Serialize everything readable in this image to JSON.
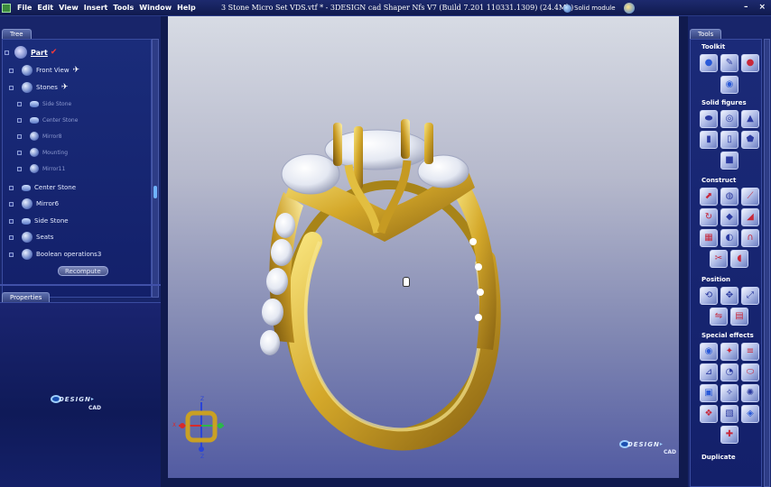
{
  "menubar": {
    "items": [
      "File",
      "Edit",
      "View",
      "Insert",
      "Tools",
      "Window",
      "Help"
    ],
    "title": "3 Stone Micro Set VDS.vtf * -  3DESIGN cad Shaper Nfs V7  (Build 7.201 110331.1309)  (24.4Mb)",
    "solid_module": "Solid module",
    "min_symbol": "–",
    "close_symbol": "×"
  },
  "tree": {
    "tab": "Tree",
    "part_label": "Part",
    "part_check": "✔",
    "items": [
      {
        "label": "Front View",
        "wing": "✈"
      },
      {
        "label": "Stones",
        "wing": "✈"
      },
      {
        "label": "Side Stone"
      },
      {
        "label": "Center Stone"
      },
      {
        "label": "Mirror8"
      },
      {
        "label": "Mounting"
      },
      {
        "label": "Mirror11"
      },
      {
        "label": "Center Stone"
      },
      {
        "label": "Mirror6"
      },
      {
        "label": "Side Stone"
      },
      {
        "label": "Seats"
      },
      {
        "label": "Boolean operations3"
      }
    ],
    "recompute": "Recompute"
  },
  "properties": {
    "tab": "Properties"
  },
  "logo": {
    "text": "DESIGN",
    "sub": "CAD"
  },
  "axes": {
    "x": "X",
    "y": "Y",
    "z": "Z"
  },
  "tools": {
    "tab": "Tools",
    "sections": {
      "toolkit": "Toolkit",
      "solid_figures": "Solid figures",
      "construct": "Construct",
      "position": "Position",
      "special_effects": "Special effects",
      "duplicate": "Duplicate"
    },
    "icons": {
      "toolkit": [
        "solid-sphere-icon",
        "pencil-icon",
        "sphere-red-icon",
        "globe-icon"
      ],
      "solid_figures": [
        "pill-icon",
        "torus-icon",
        "cone-icon",
        "box-face-icon",
        "cylinder-icon",
        "prism-icon",
        "cube-icon"
      ],
      "construct": [
        "extrude-icon",
        "pipe-icon",
        "sweep-icon",
        "revolve-icon",
        "loft-icon",
        "wedge-icon",
        "blend-icon",
        "skin-icon",
        "shell-icon",
        "cut-icon",
        "fillet-icon"
      ],
      "position": [
        "rotate-icon",
        "move-icon",
        "scale-icon",
        "mirror-icon",
        "align-icon"
      ],
      "special_effects": [
        "deform-icon",
        "twist-icon",
        "bend-icon",
        "taper-icon",
        "morph-icon",
        "emboss-icon",
        "texture-icon",
        "engrave-icon",
        "pave-icon",
        "bevel-icon",
        "pattern-icon",
        "gem-icon"
      ]
    }
  }
}
